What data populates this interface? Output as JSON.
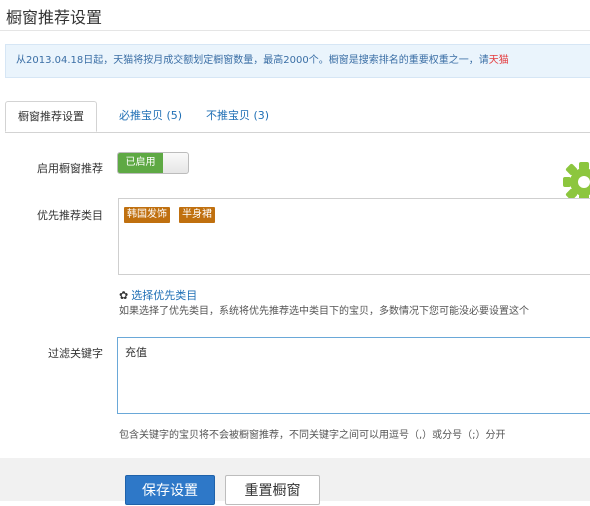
{
  "page": {
    "title": "橱窗推荐设置"
  },
  "notice": {
    "text": "从2013.04.18日起，天猫将按月成交额划定橱窗数量，最高2000个。橱窗是搜索排名的重要权重之一，请",
    "emphasis": "天猫"
  },
  "tabs": [
    {
      "label": "橱窗推荐设置",
      "active": true
    },
    {
      "label": "必推宝贝 (5)",
      "active": false
    },
    {
      "label": "不推宝贝 (3)",
      "active": false
    }
  ],
  "enable": {
    "label": "启用橱窗推荐",
    "toggle_text": "已启用",
    "on": true
  },
  "priority": {
    "label": "优先推荐类目",
    "tags": [
      "韩国发饰",
      "半身裙"
    ],
    "choose_link": "选择优先类目",
    "hint": "如果选择了优先类目，系统将优先推荐选中类目下的宝贝，多数情况下您可能没必要设置这个"
  },
  "filter": {
    "label": "过滤关键字",
    "value": "充值",
    "hint": "包含关键字的宝贝将不会被橱窗推荐，不同关键字之间可以用逗号（,）或分号（;）分开"
  },
  "buttons": {
    "save": "保存设置",
    "reset": "重置橱窗"
  },
  "colors": {
    "accent": "#2e78c8",
    "toggle_on": "#5ea944",
    "tag": "#c0700f",
    "emphasis": "#e4393c"
  },
  "icons": {
    "choose": "gear-icon",
    "decor": "gear-icon"
  }
}
